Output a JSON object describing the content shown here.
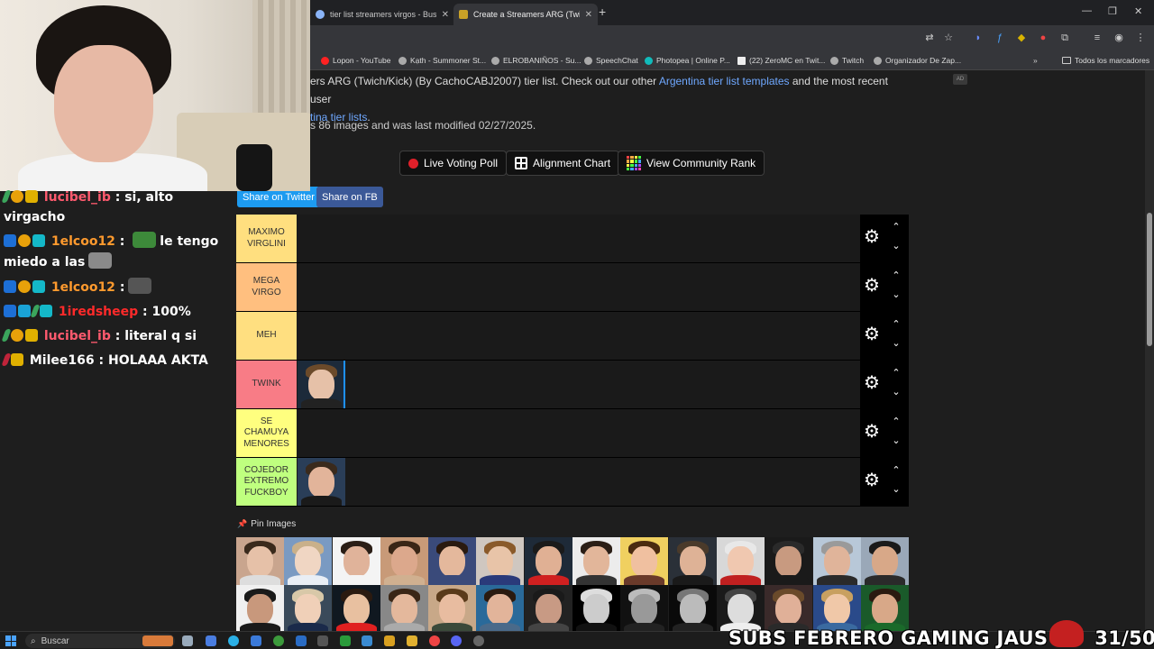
{
  "browser": {
    "tabs": [
      {
        "title": "tier list streamers virgos - Busca"
      },
      {
        "title": "Create a Streamers ARG (Twitch/"
      }
    ],
    "bookmarks": [
      "Lopon - YouTube",
      "Kạth - Summoner St...",
      "ELROBANIÑOS - Su...",
      "SpeechChat",
      "Photopea | Online P...",
      "(22) ZeroMC en Twit...",
      "Twitch",
      "Organizador De Zap...",
      "Todos los marcadores"
    ]
  },
  "page": {
    "intro_line1_start": "ers ARG (Twich/Kick) (By CachoCABJ2007) tier list. Check out our other ",
    "intro_link1": "Argentina tier list templates",
    "intro_line1_end": " and the most recent user",
    "intro_link2": "tina tier lists",
    "intro_line2_end": ".",
    "meta": "s 86 images and was last modified 02/27/2025.",
    "ad_label": "AD",
    "buttons": {
      "live_voting": "Live Voting Poll",
      "alignment": "Alignment Chart",
      "community_rank": "View Community Rank"
    },
    "share_twitter": "Share on Twitter",
    "share_fb": "Share on FB",
    "tiers": [
      {
        "label": "MAXIMO VIRGLINI",
        "color": "#ffdf7f"
      },
      {
        "label": "MEGA VIRGO",
        "color": "#ffbf7f"
      },
      {
        "label": "MEH",
        "color": "#ffdf80"
      },
      {
        "label": "TWINK",
        "color": "#f87c86"
      },
      {
        "label": "SE CHAMUYA MENORES",
        "color": "#ffff7f"
      },
      {
        "label": "COJEDOR EXTREMO FUCKBOY",
        "color": "#bfff7f"
      }
    ],
    "pin_images": "Pin Images"
  },
  "chat": [
    {
      "user": "lucibel_ib",
      "text": ": si, alto",
      "cont": "virgacho",
      "color": "#ff5a6e"
    },
    {
      "user": "1elcoo12",
      "text": "le tengo",
      "cont": "miedo a las",
      "color": "#ff9a2e"
    },
    {
      "user": "1elcoo12",
      "text": ":",
      "color": "#ff9a2e"
    },
    {
      "user": "1iredsheep",
      "text": ": 100%",
      "color": "#ff2a2a"
    },
    {
      "user": "lucibel_ib",
      "text": ": literal q si",
      "color": "#ff5a6e"
    },
    {
      "user": "Milee166",
      "text": ": HOLAAA AKTA",
      "color": "#ffffff"
    }
  ],
  "taskbar": {
    "search_placeholder": "Buscar"
  },
  "overlay": {
    "subs_text": "SUBS FEBRERO GAMING JAUS",
    "subs_count": "31/50"
  }
}
